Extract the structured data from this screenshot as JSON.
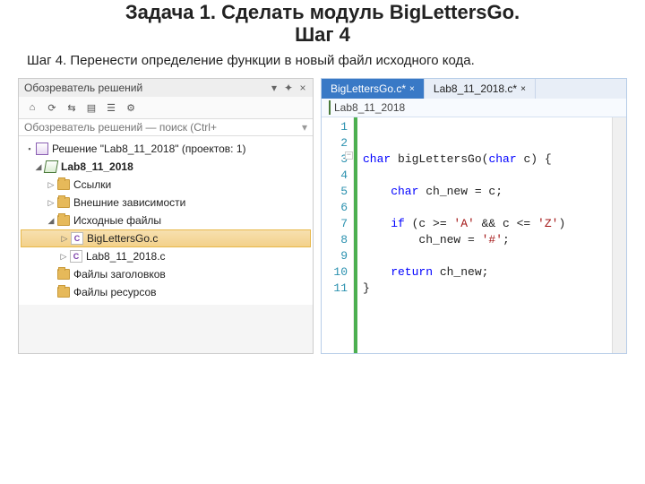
{
  "title": "Задача 1. Сделать модуль BigLettersGo.",
  "subtitle": "Шаг 4",
  "description": "Шаг 4. Перенести определение функции в новый файл исходного кода.",
  "panel": {
    "title": "Обозреватель решений",
    "btn_dropdown": "▾",
    "btn_pin": "✦",
    "btn_close": "×",
    "search_placeholder": "Обозреватель решений — поиск (Ctrl+",
    "tb": {
      "home": "⌂",
      "refresh": "⟳",
      "sync": "⇆",
      "props": "☰",
      "all": "▤",
      "props2": "⚙"
    }
  },
  "tree": {
    "solution": "Решение \"Lab8_11_2018\" (проектов: 1)",
    "project": "Lab8_11_2018",
    "refs": "Ссылки",
    "ext": "Внешние зависимости",
    "src": "Исходные файлы",
    "file1": "BigLettersGo.c",
    "file2": "Lab8_11_2018.c",
    "hdr": "Файлы заголовков",
    "res": "Файлы ресурсов"
  },
  "editor": {
    "tab1": "BigLettersGo.c*",
    "tab2": "Lab8_11_2018.c*",
    "crumb": "Lab8_11_2018",
    "code": {
      "l3a": "char",
      "l3b": " bigLettersGo(",
      "l3c": "char",
      "l3d": " c) {",
      "l5a": "    char",
      "l5b": " ch_new = c;",
      "l7a": "    if",
      "l7b": " (c >= ",
      "l7c": "'A'",
      "l7d": " && c <= ",
      "l7e": "'Z'",
      "l7f": ")",
      "l8a": "        ch_new = ",
      "l8b": "'#'",
      "l8c": ";",
      "l10a": "    return",
      "l10b": " ch_new;",
      "l11": "}"
    },
    "lines": [
      "1",
      "2",
      "3",
      "4",
      "5",
      "6",
      "7",
      "8",
      "9",
      "10",
      "11"
    ]
  }
}
